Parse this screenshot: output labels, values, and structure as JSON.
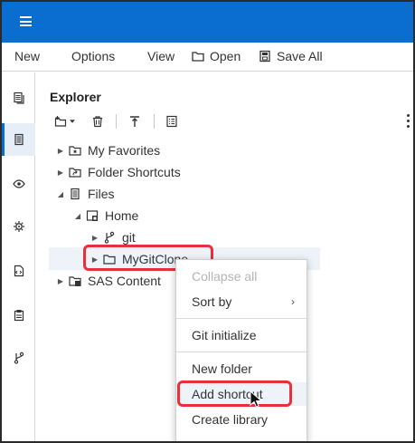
{
  "menubar": {
    "items": [
      {
        "label": "New"
      },
      {
        "label": "Options"
      },
      {
        "label": "View"
      },
      {
        "label": "Open"
      },
      {
        "label": "Save All"
      }
    ]
  },
  "explorer": {
    "title": "Explorer",
    "tree": [
      {
        "label": "My Favorites"
      },
      {
        "label": "Folder Shortcuts"
      },
      {
        "label": "Files"
      },
      {
        "label": "Home"
      },
      {
        "label": "git"
      },
      {
        "label": "MyGitClone"
      },
      {
        "label": "SAS Content"
      }
    ]
  },
  "context_menu": {
    "items": [
      {
        "label": "Collapse all"
      },
      {
        "label": "Sort by"
      },
      {
        "label": "Git initialize"
      },
      {
        "label": "New folder"
      },
      {
        "label": "Add shortcut"
      },
      {
        "label": "Create library"
      }
    ]
  },
  "colors": {
    "accent": "#0a6ed1",
    "highlight": "#e8303a",
    "disabled_text": "#b5b5b5"
  }
}
